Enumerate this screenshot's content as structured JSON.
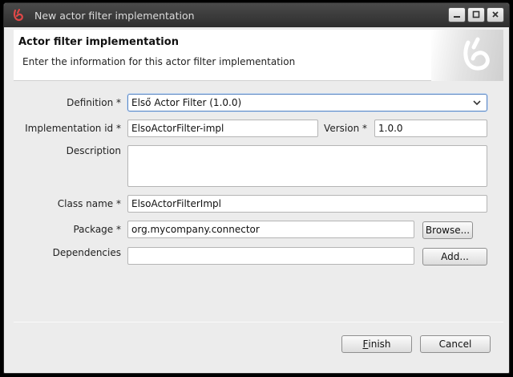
{
  "window": {
    "title": "New actor filter implementation"
  },
  "header": {
    "title": "Actor filter implementation",
    "subtitle": "Enter the information for this actor filter implementation"
  },
  "form": {
    "definition": {
      "label": "Definition *",
      "value": "Első Actor Filter (1.0.0)"
    },
    "implementation_id": {
      "label": "Implementation id *",
      "value": "ElsoActorFilter-impl"
    },
    "version": {
      "label": "Version *",
      "value": "1.0.0"
    },
    "description": {
      "label": "Description",
      "value": ""
    },
    "class_name": {
      "label": "Class name *",
      "value": "ElsoActorFilterImpl"
    },
    "package": {
      "label": "Package *",
      "value": "org.mycompany.connector"
    },
    "dependencies": {
      "label": "Dependencies",
      "value": ""
    }
  },
  "buttons": {
    "browse": "Browse...",
    "add": "Add...",
    "finish_first": "F",
    "finish_rest": "inish",
    "cancel": "Cancel"
  },
  "colors": {
    "titlebar": "#3a3a3a",
    "accent_red": "#d03030",
    "focus_border": "#5b86c2"
  },
  "icons": {
    "app": "app-logo-icon",
    "minimize": "minimize-icon",
    "maximize": "maximize-icon",
    "close": "close-icon",
    "dropdown": "chevron-down-icon"
  }
}
